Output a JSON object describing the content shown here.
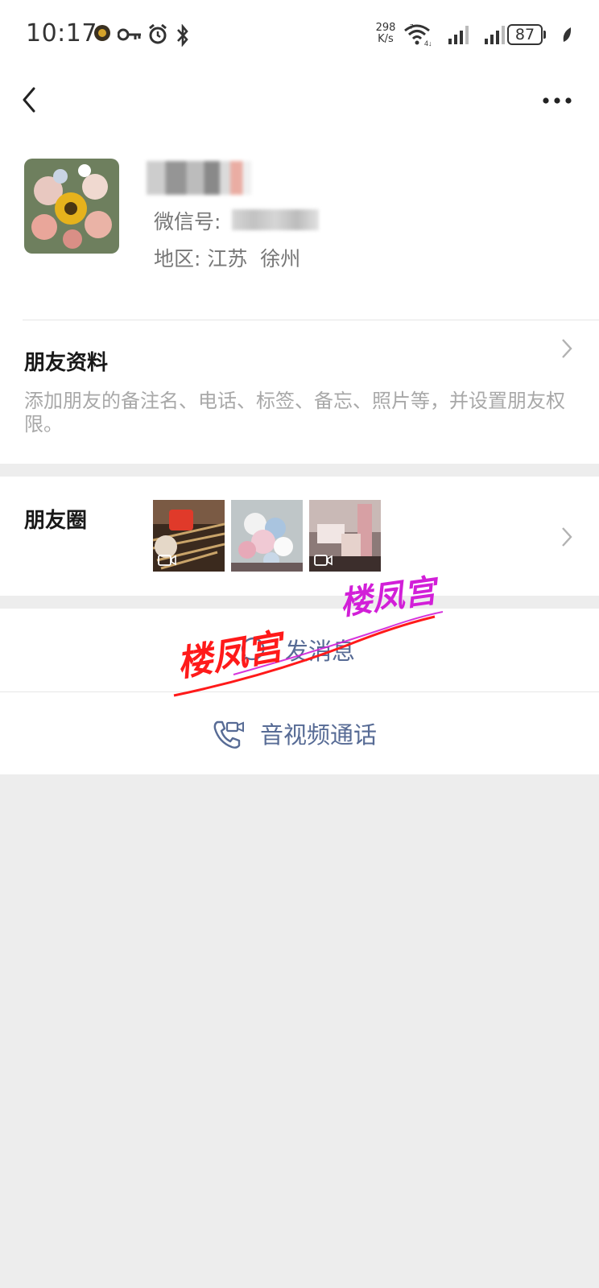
{
  "status_bar": {
    "time": "10:17",
    "net_speed_value": "298",
    "net_speed_unit": "K/s",
    "battery": "87",
    "icons": [
      "app-notification-icon",
      "vpn-key-icon",
      "alarm-icon",
      "bluetooth-icon",
      "wifi-icon",
      "signal-icon",
      "signal-icon",
      "leaf-icon"
    ]
  },
  "nav": {
    "back_icon": "chevron-left-icon",
    "more_icon": "more-dots-icon"
  },
  "profile": {
    "wechat_id_label": "微信号:",
    "region_label": "地区: 江苏  徐州"
  },
  "friend_info": {
    "title": "朋友资料",
    "description": "添加朋友的备注名、电话、标签、备忘、照片等，并设置朋友权限。"
  },
  "moments": {
    "title": "朋友圈",
    "thumbnails": [
      {
        "subject": "barbecue",
        "video": true
      },
      {
        "subject": "flower-bouquet",
        "video": false
      },
      {
        "subject": "gift-boxes",
        "video": true
      }
    ]
  },
  "actions": {
    "send_message": "发消息",
    "video_call": "音视频通话"
  },
  "watermarks": [
    "楼凤宫",
    "楼凤宫"
  ],
  "colors": {
    "link_blue": "#576b95",
    "background": "#ededed",
    "watermark_red": "#ff1a1a",
    "watermark_magenta": "#d21fd8"
  }
}
